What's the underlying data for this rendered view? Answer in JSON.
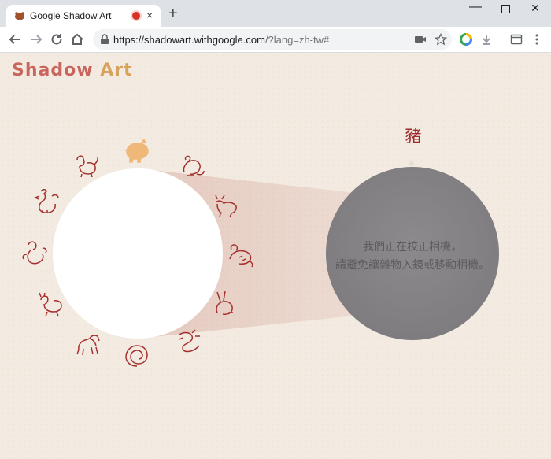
{
  "browser": {
    "tab_title": "Google Shadow Art",
    "url_host": "https://shadowart.withgoogle.com",
    "url_rest": "/?lang=zh-tw#",
    "new_tab": "+",
    "tab_close": "×",
    "win_min": "—",
    "win_close": "✕"
  },
  "page": {
    "logo": {
      "part1": "Shadow",
      "part2": " Art"
    },
    "zodiac_name": "豬",
    "calibration_line1": "我們正在校正相機，",
    "calibration_line2": "請避免讓雜物入鏡或移動相機。",
    "colors": {
      "background": "#f3ebe1",
      "accent_red": "#9b2a2a",
      "selected_animal": "#f0b878",
      "camera": "#807e81"
    },
    "zodiac_ring": [
      {
        "name": "pig-icon",
        "selected": true
      },
      {
        "name": "rat-icon",
        "selected": false
      },
      {
        "name": "ox-icon",
        "selected": false
      },
      {
        "name": "tiger-icon",
        "selected": false
      },
      {
        "name": "rabbit-icon",
        "selected": false
      },
      {
        "name": "dragon-icon",
        "selected": false
      },
      {
        "name": "snake-icon",
        "selected": false
      },
      {
        "name": "horse-icon",
        "selected": false
      },
      {
        "name": "goat-icon",
        "selected": false
      },
      {
        "name": "monkey-icon",
        "selected": false
      },
      {
        "name": "rooster-icon",
        "selected": false
      },
      {
        "name": "dog-icon",
        "selected": false
      }
    ]
  }
}
